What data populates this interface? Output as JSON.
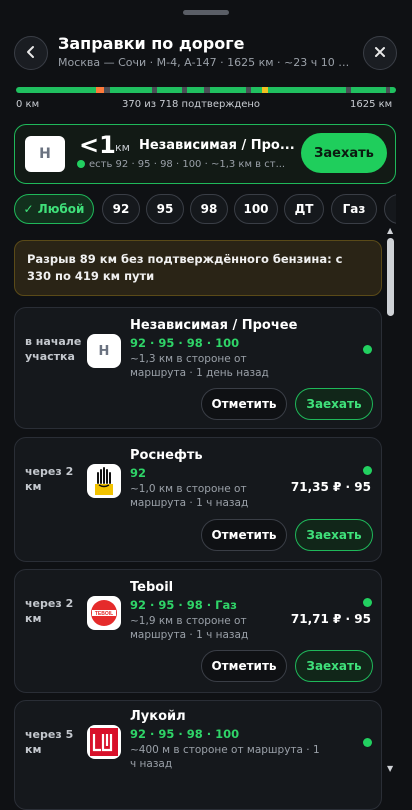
{
  "header": {
    "title": "Заправки по дороге",
    "subtitle": "Москва — Сочи · М-4, А-147 · 1625 км · ~23 ч 10 м..."
  },
  "progress": {
    "start_label": "0 км",
    "middle_label": "370 из 718 подтверждено",
    "end_label": "1625 км",
    "confirmed": 370,
    "total": 718,
    "colors": {
      "ok": "#20c060",
      "gap": "#4a4e56",
      "warn": "#ff7a3a",
      "caution": "#f0c020"
    }
  },
  "nearest": {
    "logo": "Н",
    "distance": "<1",
    "unit": "км",
    "name": "Независимая / Про...",
    "details": "есть 92 · 95 · 98 · 100 · ~1,3 км в ст...",
    "button": "Заехать"
  },
  "filters": [
    {
      "label": "✓ Любой",
      "active": true
    },
    {
      "label": "92",
      "active": false
    },
    {
      "label": "95",
      "active": false
    },
    {
      "label": "98",
      "active": false
    },
    {
      "label": "100",
      "active": false
    },
    {
      "label": "ДТ",
      "active": false
    },
    {
      "label": "Газ",
      "active": false
    }
  ],
  "warning": "Разрыв 89 км без подтверждённого бензина: с 330 по 419 км пути",
  "stations": [
    {
      "when": "в начале участка",
      "logo": "Н",
      "name": "Независимая / Прочее",
      "fuels": "92 · 95 · 98 · 100",
      "info": "~1,3 км в стороне от маршрута · 1 день назад",
      "price": "",
      "mark": "Отметить",
      "go": "Заехать"
    },
    {
      "when": "через 2 км",
      "logo": "rosneft-logo",
      "name": "Роснефть",
      "fuels": "92",
      "info": "~1,0 км в стороне от маршрута · 1 ч назад",
      "price": "71,35 ₽ · 95",
      "mark": "Отметить",
      "go": "Заехать"
    },
    {
      "when": "через 2 км",
      "logo": "teboil-logo",
      "logo_text": "TEBOIL",
      "name": "Teboil",
      "fuels": "92 · 95 · 98 · Газ",
      "info": "~1,9 км в стороне от маршрута · 1 ч назад",
      "price": "71,71 ₽ · 95",
      "mark": "Отметить",
      "go": "Заехать"
    },
    {
      "when": "через 5 км",
      "logo": "lukoil-logo",
      "name": "Лукойл",
      "fuels": "92 · 95 · 98 · 100",
      "info": "~400 м в стороне от маршрута · 1 ч назад",
      "price": ""
    }
  ]
}
